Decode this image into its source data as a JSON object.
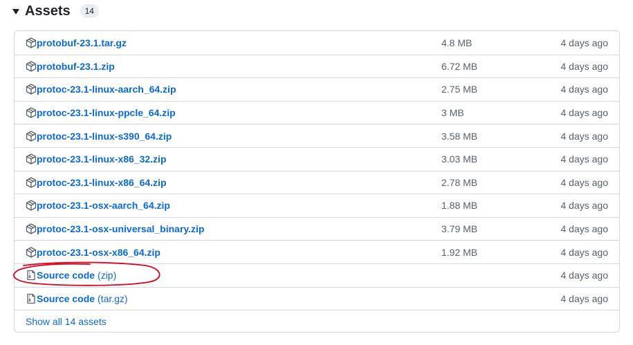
{
  "header": {
    "title": "Assets",
    "count": "14"
  },
  "assets": [
    {
      "name": "protobuf-23.1.tar.gz",
      "suffix": "",
      "size": "4.8 MB",
      "date": "4 days ago",
      "icon": "package-icon"
    },
    {
      "name": "protobuf-23.1.zip",
      "suffix": "",
      "size": "6.72 MB",
      "date": "4 days ago",
      "icon": "package-icon"
    },
    {
      "name": "protoc-23.1-linux-aarch_64.zip",
      "suffix": "",
      "size": "2.75 MB",
      "date": "4 days ago",
      "icon": "package-icon"
    },
    {
      "name": "protoc-23.1-linux-ppcle_64.zip",
      "suffix": "",
      "size": "3 MB",
      "date": "4 days ago",
      "icon": "package-icon"
    },
    {
      "name": "protoc-23.1-linux-s390_64.zip",
      "suffix": "",
      "size": "3.58 MB",
      "date": "4 days ago",
      "icon": "package-icon"
    },
    {
      "name": "protoc-23.1-linux-x86_32.zip",
      "suffix": "",
      "size": "3.03 MB",
      "date": "4 days ago",
      "icon": "package-icon"
    },
    {
      "name": "protoc-23.1-linux-x86_64.zip",
      "suffix": "",
      "size": "2.78 MB",
      "date": "4 days ago",
      "icon": "package-icon"
    },
    {
      "name": "protoc-23.1-osx-aarch_64.zip",
      "suffix": "",
      "size": "1.88 MB",
      "date": "4 days ago",
      "icon": "package-icon"
    },
    {
      "name": "protoc-23.1-osx-universal_binary.zip",
      "suffix": "",
      "size": "3.79 MB",
      "date": "4 days ago",
      "icon": "package-icon"
    },
    {
      "name": "protoc-23.1-osx-x86_64.zip",
      "suffix": "",
      "size": "1.92 MB",
      "date": "4 days ago",
      "icon": "package-icon"
    },
    {
      "name": "Source code",
      "suffix": "(zip)",
      "size": "",
      "date": "4 days ago",
      "icon": "file-zip-icon"
    },
    {
      "name": "Source code",
      "suffix": "(tar.gz)",
      "size": "",
      "date": "4 days ago",
      "icon": "file-zip-icon"
    }
  ],
  "footer": {
    "show_all": "Show all 14 assets"
  },
  "colors": {
    "link": "#0969da",
    "muted": "#57606a",
    "border": "#d0d7de",
    "annotation": "#e0001b"
  }
}
